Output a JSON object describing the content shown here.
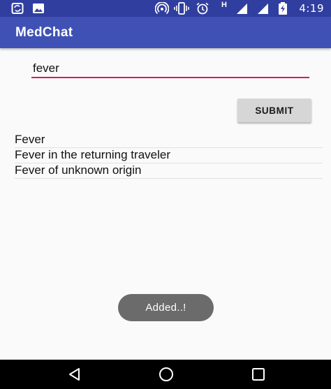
{
  "status_bar": {
    "time": "4:19",
    "network": "H",
    "icons": [
      "sync-icon",
      "image-icon",
      "hotspot-icon",
      "vibrate-icon",
      "alarm-icon",
      "signal-icon",
      "signal-icon",
      "battery-charging-icon"
    ]
  },
  "app_bar": {
    "title": "MedChat"
  },
  "search": {
    "value": "fever"
  },
  "submit": {
    "label": "SUBMIT"
  },
  "results": [
    "Fever",
    "Fever in the returning traveler",
    "Fever of unknown origin"
  ],
  "toast": {
    "text": "Added..!"
  },
  "nav_bar": {
    "icons": [
      "back-icon",
      "home-icon",
      "recents-icon"
    ]
  },
  "colors": {
    "primary": "#3f51b5",
    "primary_dark": "#303f9f",
    "accent": "#d81b60",
    "toast": "#6b6b6b"
  }
}
